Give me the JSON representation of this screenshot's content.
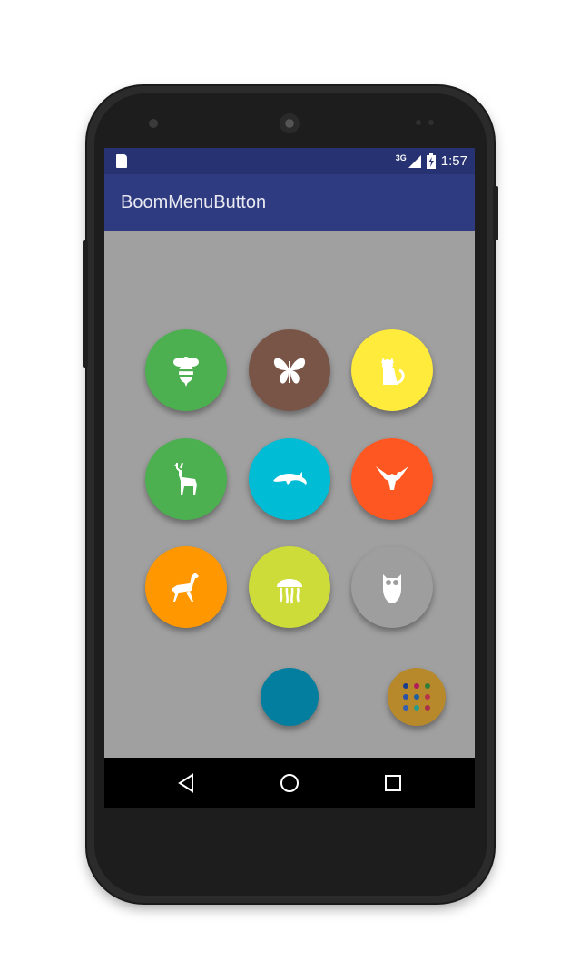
{
  "status_bar": {
    "network_label": "3G",
    "time": "1:57",
    "icons": [
      "sd-card-icon",
      "signal-icon",
      "battery-icon"
    ]
  },
  "app_bar": {
    "title": "BoomMenuButton"
  },
  "boom_menu": {
    "items": [
      {
        "name": "bee",
        "icon": "bee-icon",
        "color": "#4CAF50"
      },
      {
        "name": "butterfly",
        "icon": "butterfly-icon",
        "color": "#795548"
      },
      {
        "name": "cat",
        "icon": "cat-icon",
        "color": "#FFEB3B"
      },
      {
        "name": "deer",
        "icon": "deer-icon",
        "color": "#4CAF50"
      },
      {
        "name": "dolphin",
        "icon": "dolphin-icon",
        "color": "#00BCD4"
      },
      {
        "name": "eagle",
        "icon": "eagle-icon",
        "color": "#FF5722"
      },
      {
        "name": "horse",
        "icon": "horse-icon",
        "color": "#FF9800"
      },
      {
        "name": "jellyfish",
        "icon": "jellyfish-icon",
        "color": "#CDDC39"
      },
      {
        "name": "owl",
        "icon": "owl-icon",
        "color": "#9E9E9E"
      }
    ],
    "extra_button_color": "#037E9E",
    "main_button_color": "#B8892A",
    "main_button_dot_colors": [
      "#1E3C8C",
      "#B01C5A",
      "#2E7D3A",
      "#2C4FA8",
      "#1E5FA0",
      "#B8324A",
      "#355FB0",
      "#2A9A8A",
      "#A83048"
    ]
  },
  "nav_bar": {
    "icons": [
      "back-icon",
      "home-icon",
      "recents-icon"
    ]
  }
}
